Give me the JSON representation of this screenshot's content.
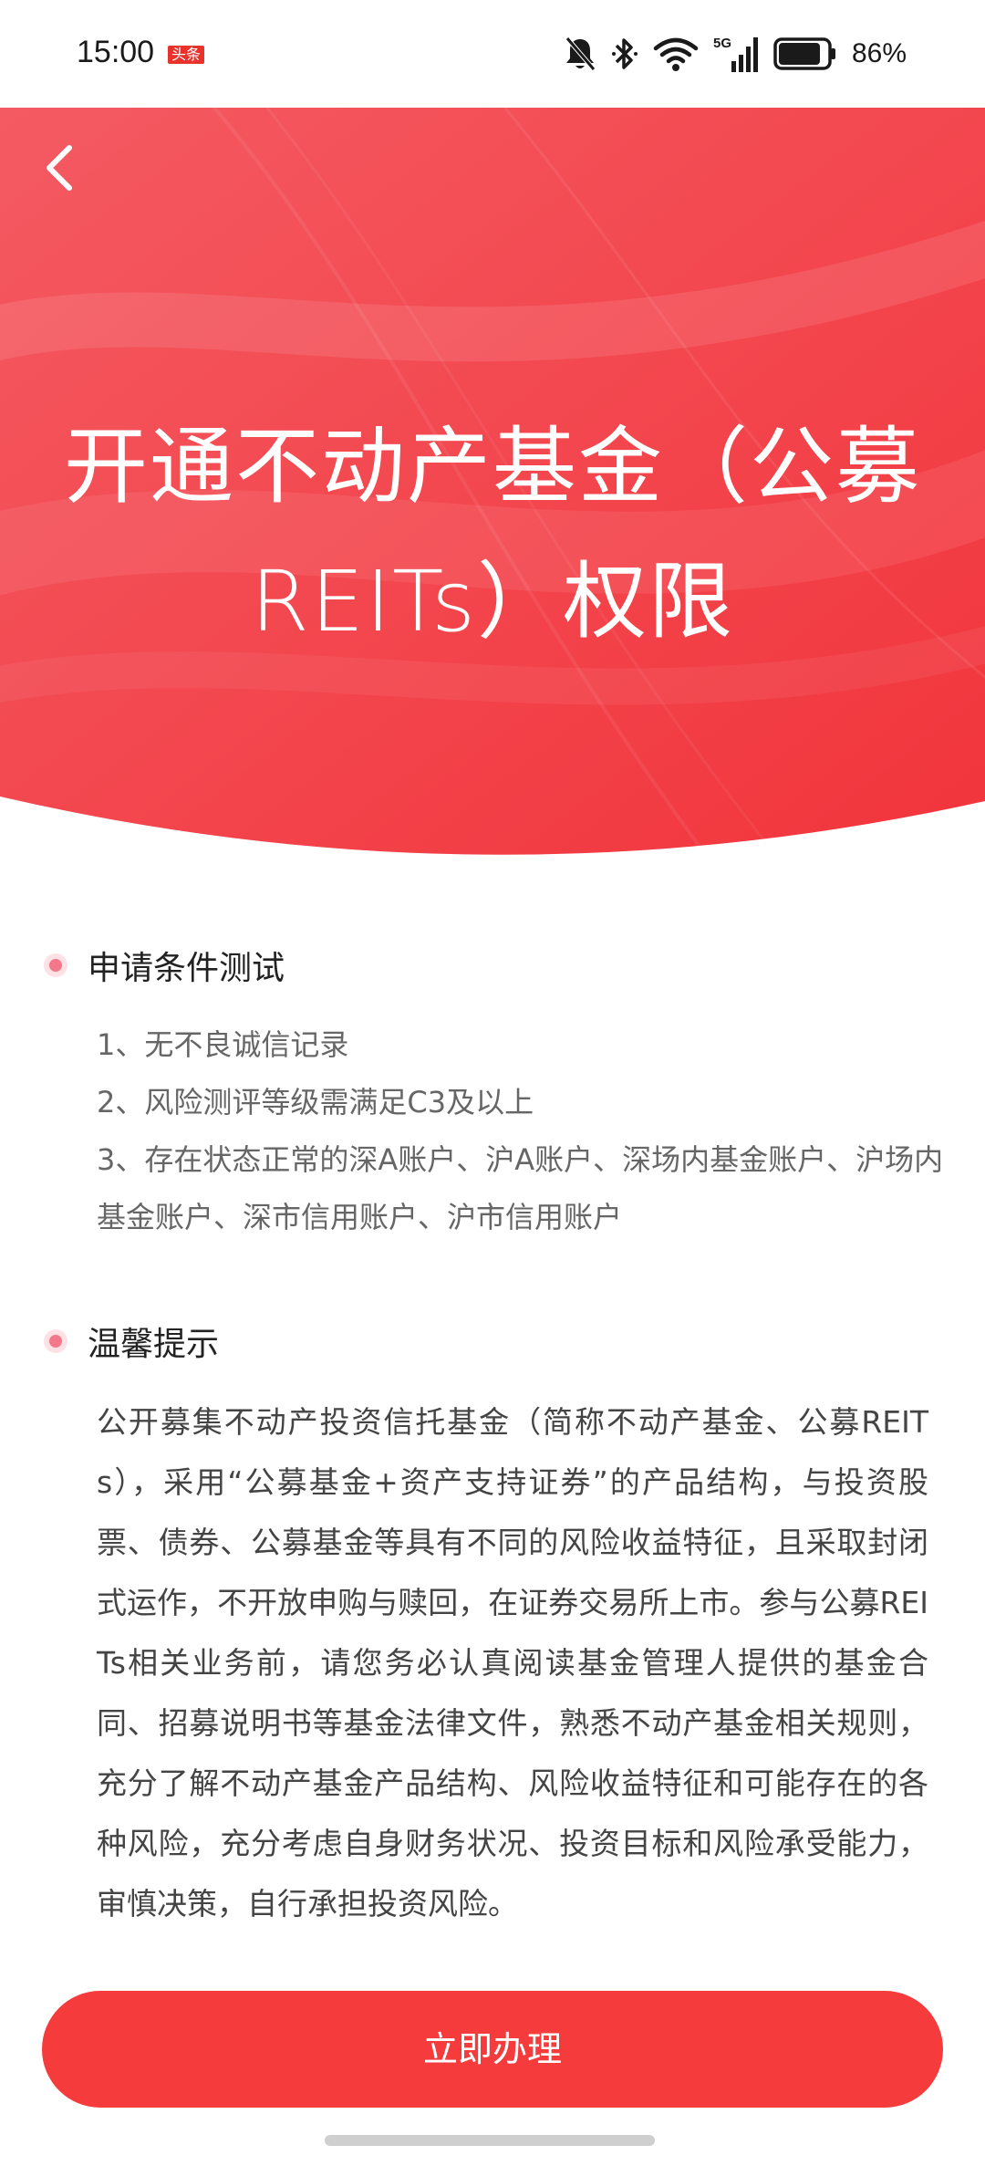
{
  "status_bar": {
    "time": "15:00",
    "app_badge": "头条",
    "network_label": "5G",
    "battery_percent": "86%",
    "battery_level": 0.86
  },
  "header": {
    "back_icon": "chevron-left-icon",
    "title": "开通不动产基金（公募REITs）权限"
  },
  "colors": {
    "brand_red": "#f53b3b",
    "hero_gradient_start": "#f45a62",
    "hero_gradient_end": "#f2343b",
    "bullet_outer": "#fde1e4",
    "bullet_inner": "#f3788a"
  },
  "conditions": {
    "title": "申请条件测试",
    "items": [
      "1、无不良诚信记录",
      "2、风险测评等级需满足C3及以上",
      "3、存在状态正常的深A账户、沪A账户、深场内基金账户、沪场内基金账户、深市信用账户、沪市信用账户"
    ]
  },
  "tips": {
    "title": "温馨提示",
    "body": "公开募集不动产投资信托基金（简称不动产基金、公募REITs），采用“公募基金+资产支持证券”的产品结构，与投资股票、债券、公募基金等具有不同的风险收益特征，且采取封闭式运作，不开放申购与赎回，在证券交易所上市。参与公募REITs相关业务前，请您务必认真阅读基金管理人提供的基金合同、招募说明书等基金法律文件，熟悉不动产基金相关规则，充分了解不动产基金产品结构、风险收益特征和可能存在的各种风险，充分考虑自身财务状况、投资目标和风险承受能力，审慎决策，自行承担投资风险。"
  },
  "actions": {
    "apply_label": "立即办理"
  }
}
